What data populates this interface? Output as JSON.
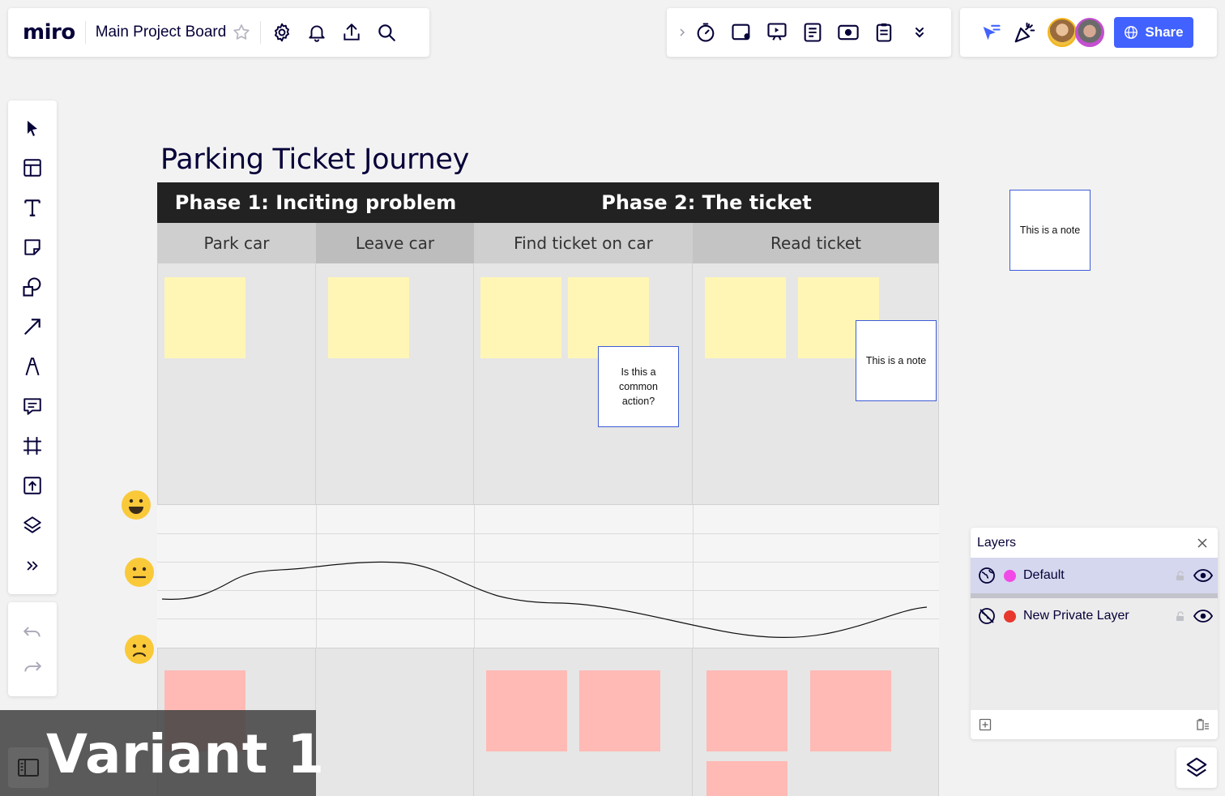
{
  "header": {
    "logo": "miro",
    "board_title": "Main Project Board",
    "share_label": "Share"
  },
  "board": {
    "title": "Parking Ticket Journey",
    "phases": [
      {
        "label": "Phase 1: Inciting problem"
      },
      {
        "label": "Phase 2: The ticket"
      }
    ],
    "steps": [
      {
        "label": "Park car"
      },
      {
        "label": "Leave car"
      },
      {
        "label": "Find ticket on car"
      },
      {
        "label": "Read ticket"
      }
    ],
    "notes": [
      {
        "text": "Is this a common action?"
      },
      {
        "text": "This is a note"
      },
      {
        "text": "This is a note"
      }
    ],
    "emotions": [
      "happy-face-icon",
      "neutral-face-icon",
      "sad-face-icon"
    ]
  },
  "layers": {
    "title": "Layers",
    "items": [
      {
        "name": "Default",
        "color": "#f24ae6"
      },
      {
        "name": "New Private Layer",
        "color": "#e8372c"
      }
    ]
  },
  "overlay": {
    "variant_label": "Variant 1"
  },
  "colors": {
    "accent": "#4262ff",
    "sticky_yellow": "#fff6b6",
    "sticky_red": "#ffbab5",
    "phase_bar": "#222222"
  }
}
